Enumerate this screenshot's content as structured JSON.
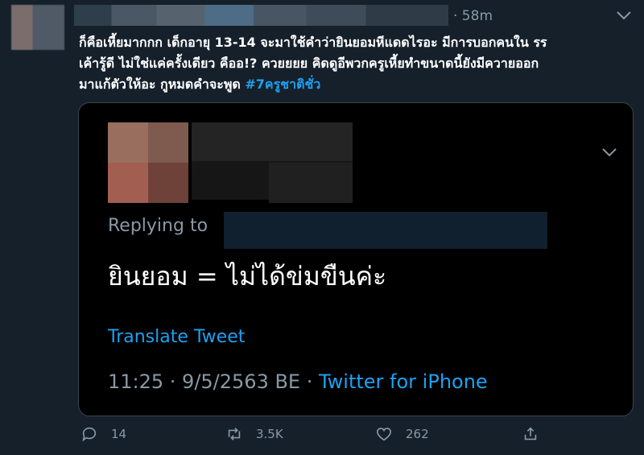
{
  "tweet": {
    "time": "· 58m",
    "text_line1": "ก็คือเหี้ยมากกก เด็กอายุ 13-14 จะมาใช้คำว่ายินยอมหีแดดไรอะ มีการบอกคนใน รร",
    "text_line2": "เค้ารู้ดี ไม่ใช่แค่ครั้งเดียว คืออ!? ควยยยย คิดดูอีพวกครูเหี้ยทำขนาดนี้ยังมีควายออก",
    "text_line3": "มาแก้ตัวให้อะ กูหมดคำจะพูด",
    "hashtag": "#7ครูชาติชั่ว"
  },
  "quote": {
    "replying_to": "Replying to",
    "text": "ยินยอม = ไม่ได้ข่มขืนค่ะ",
    "translate": "Translate Tweet",
    "meta_time": "11:25 · 9/5/2563 BE · ",
    "source": "Twitter for iPhone"
  },
  "actions": {
    "replies": "14",
    "retweets": "3.5K",
    "likes": "262"
  }
}
